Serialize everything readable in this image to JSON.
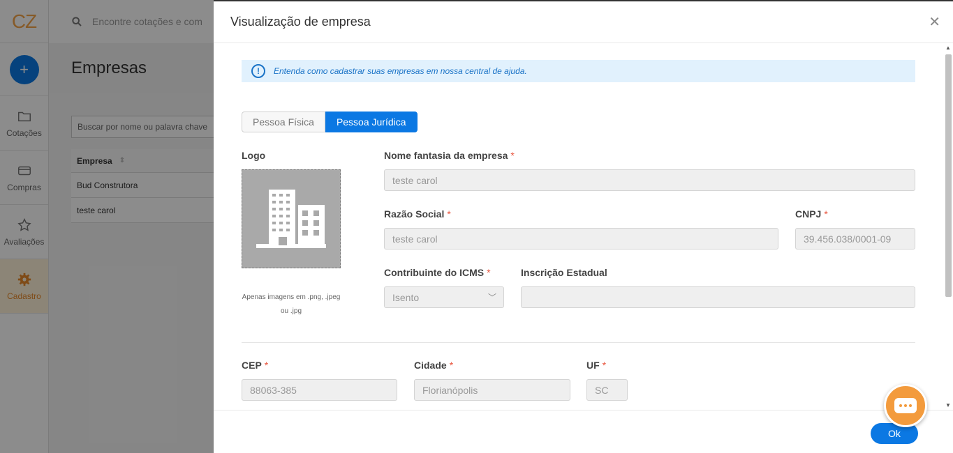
{
  "sidebar": {
    "logo": "CZ",
    "add_label": "+",
    "items": [
      {
        "label": "Cotações",
        "icon": "folder-icon",
        "active": false
      },
      {
        "label": "Compras",
        "icon": "credit-card-icon",
        "active": false
      },
      {
        "label": "Avaliações",
        "icon": "star-icon",
        "active": false
      },
      {
        "label": "Cadastro",
        "icon": "gear-icon",
        "active": true
      }
    ]
  },
  "background": {
    "search_placeholder": "Encontre cotações e com",
    "page_title": "Empresas",
    "filter_placeholder": "Buscar por nome ou palavra chave",
    "table_header": "Empresa",
    "rows": [
      "Bud Construtora",
      "teste carol"
    ]
  },
  "drawer": {
    "title": "Visualização de empresa",
    "info_text": "Entenda como cadastrar suas empresas em nossa central de ajuda.",
    "tabs": {
      "left": "Pessoa Física",
      "right": "Pessoa Jurídica",
      "selected": "Pessoa Jurídica"
    },
    "logo_label": "Logo",
    "logo_hint": "Apenas imagens em .png, .jpeg ou .jpg",
    "fields": {
      "nome_fantasia": {
        "label": "Nome fantasia da empresa",
        "value": "teste carol",
        "required": "*"
      },
      "razao_social": {
        "label": "Razão Social",
        "value": "teste carol",
        "required": "*"
      },
      "cnpj": {
        "label": "CNPJ",
        "value": "39.456.038/0001-09",
        "required": "*"
      },
      "icms": {
        "label": "Contribuinte do ICMS",
        "value": "Isento",
        "required": "*"
      },
      "inscricao": {
        "label": "Inscrição Estadual",
        "value": ""
      },
      "cep": {
        "label": "CEP",
        "value": "88063-385",
        "required": "*"
      },
      "cidade": {
        "label": "Cidade",
        "value": "Florianópolis",
        "required": "*"
      },
      "uf": {
        "label": "UF",
        "value": "SC",
        "required": "*"
      }
    },
    "ok_label": "Ok"
  },
  "colors": {
    "primary": "#0b78e3",
    "accent": "#f39b3d",
    "info_bg": "#e1f1fd"
  }
}
